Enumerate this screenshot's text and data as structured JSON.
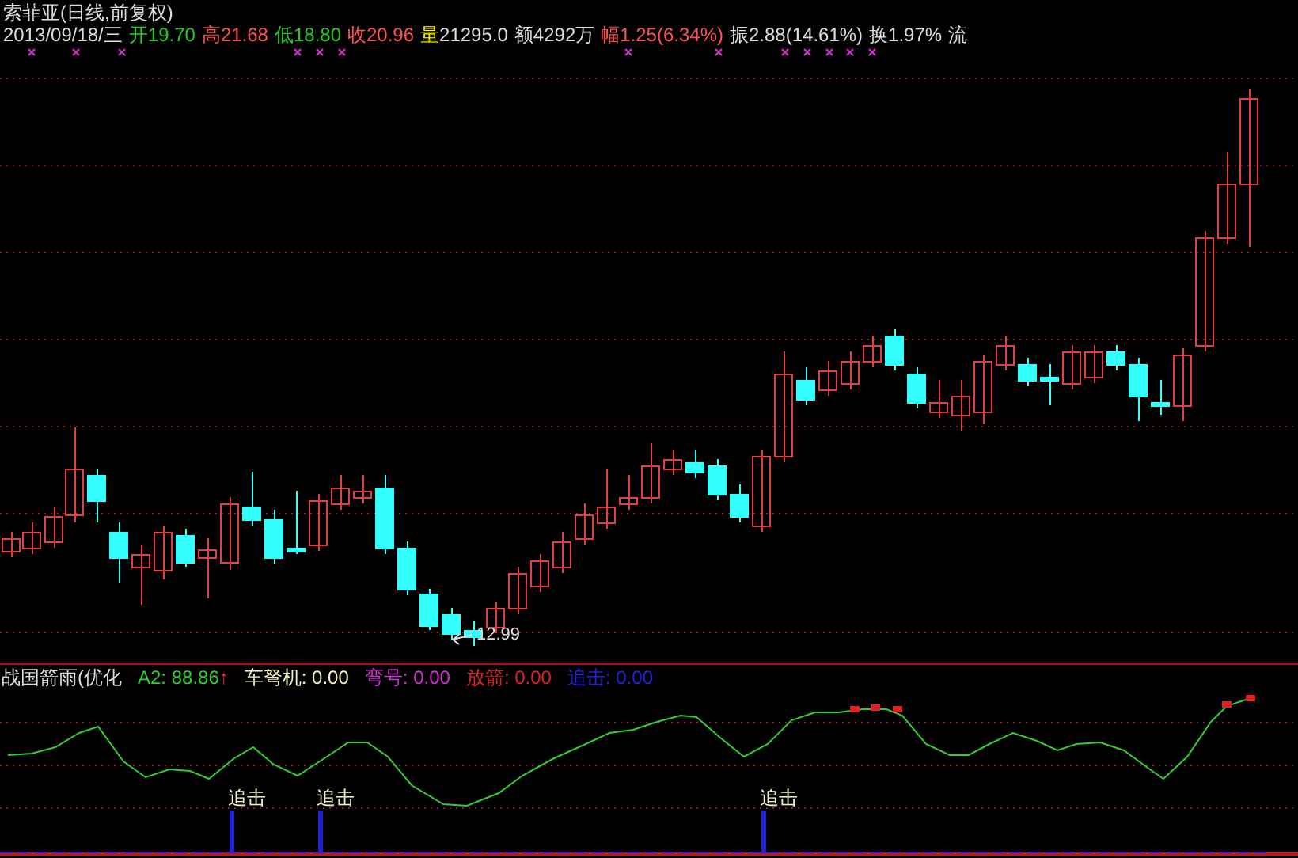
{
  "title": "索菲亚(日线,前复权)",
  "date": "2013/09/18/三",
  "stats": [
    {
      "label": {
        "text": "开",
        "color": "#22cc22"
      },
      "value": {
        "text": "19.70",
        "color": "#22cc22"
      }
    },
    {
      "label": {
        "text": "高",
        "color": "#ff5050"
      },
      "value": {
        "text": "21.68",
        "color": "#ff5050"
      }
    },
    {
      "label": {
        "text": "低",
        "color": "#22cc22"
      },
      "value": {
        "text": "18.80",
        "color": "#22cc22"
      }
    },
    {
      "label": {
        "text": "收",
        "color": "#ff5050"
      },
      "value": {
        "text": "20.96",
        "color": "#ff5050"
      }
    },
    {
      "label": {
        "text": "量",
        "color": "#ffff00"
      },
      "value": {
        "text": "21295.0",
        "color": "#dddddd"
      }
    },
    {
      "label": {
        "text": "额",
        "color": "#dddddd"
      },
      "value": {
        "text": "4292万",
        "color": "#dddddd"
      }
    },
    {
      "label": {
        "text": "幅",
        "color": "#ff5050"
      },
      "value": {
        "text": "1.25(6.34%)",
        "color": "#ff5050"
      }
    },
    {
      "label": {
        "text": "振",
        "color": "#dddddd"
      },
      "value": {
        "text": "2.88(14.61%)",
        "color": "#dddddd"
      }
    },
    {
      "label": {
        "text": "换",
        "color": "#dddddd"
      },
      "value": {
        "text": "1.97%",
        "color": "#dddddd"
      }
    },
    {
      "label": {
        "text": "流",
        "color": "#dddddd"
      }
    }
  ],
  "low_price_label": "12.99",
  "indicator": {
    "name": "战国箭雨(优化",
    "values": [
      {
        "label": "A2: 88.86",
        "color": "#33cc33",
        "arrow": "↑"
      },
      {
        "label": "车弩机: 0.00",
        "color": "#f0f0c0"
      },
      {
        "label": "弯号: 0.00",
        "color": "#cc33cc"
      },
      {
        "label": "放箭: 0.00",
        "color": "#dd2222"
      },
      {
        "label": "追击: 0.00",
        "color": "#2222dd"
      }
    ]
  },
  "signal_labels": [
    "追击",
    "追击",
    "追击"
  ]
}
